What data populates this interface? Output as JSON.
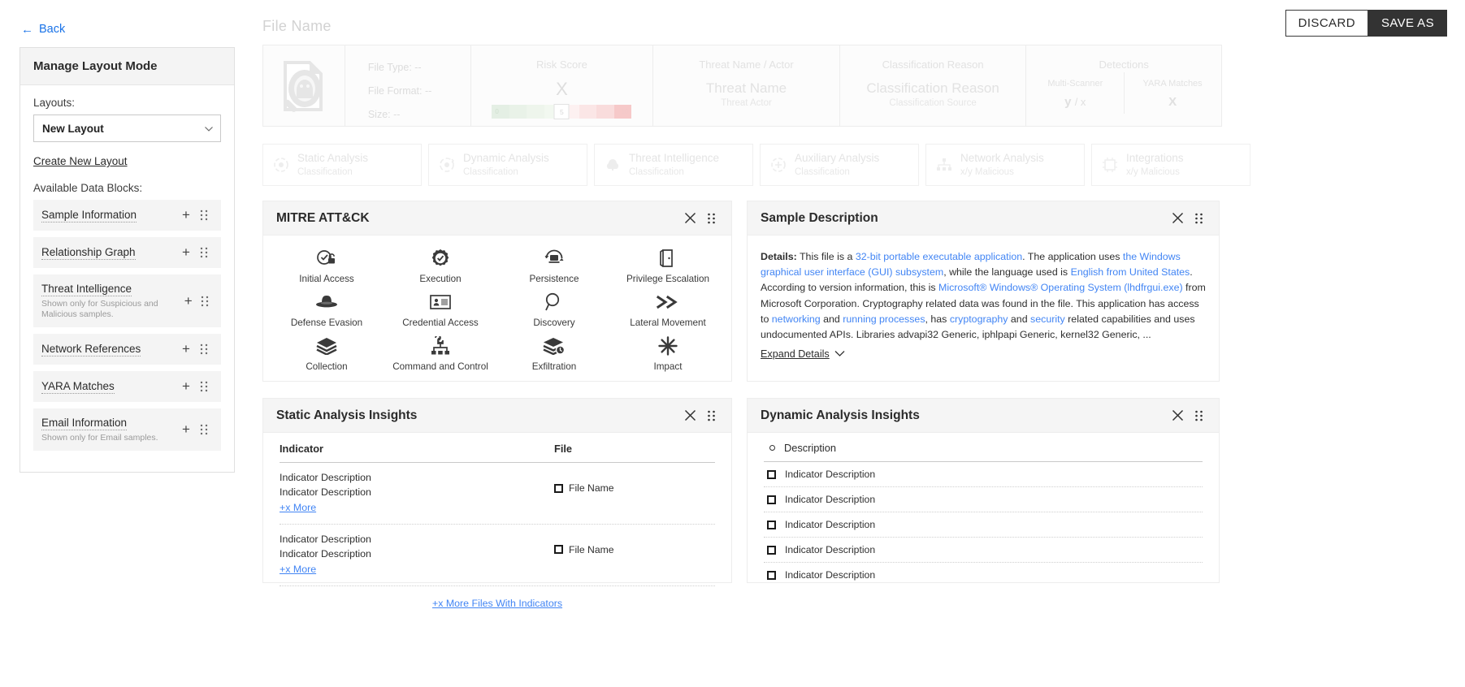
{
  "sidebar": {
    "back_label": "Back",
    "panel_title": "Manage Layout Mode",
    "layouts_label": "Layouts:",
    "selected_layout": "New Layout",
    "create_link": "Create New Layout",
    "blocks_label": "Available Data Blocks:",
    "blocks": [
      {
        "title": "Sample Information",
        "sub": ""
      },
      {
        "title": "Relationship Graph",
        "sub": ""
      },
      {
        "title": "Threat Intelligence",
        "sub": "Shown only for Suspicious and Malicious samples."
      },
      {
        "title": "Network References",
        "sub": ""
      },
      {
        "title": "YARA Matches",
        "sub": ""
      },
      {
        "title": "Email Information",
        "sub": "Shown only for Email samples."
      }
    ]
  },
  "topbar": {
    "file_name": "File  Name",
    "discard_label": "DISCARD",
    "save_as_label": "SAVE AS"
  },
  "summary": {
    "meta": {
      "file_type": "File Type:  --",
      "file_format": "File Format:  --",
      "size": "Size:  --"
    },
    "risk": {
      "header": "Risk Score",
      "value": "X",
      "min": "0",
      "mid": "5",
      "max": "10"
    },
    "threat": {
      "header": "Threat Name / Actor",
      "name": "Threat Name",
      "actor": "Threat Actor"
    },
    "classification": {
      "header": "Classification Reason",
      "name": "Classification Reason",
      "source": "Classification Source"
    },
    "detections": {
      "header": "Detections",
      "multi_scanner_label": "Multi-Scanner",
      "multi_scanner_value": "y",
      "multi_scanner_total": "/ x",
      "yara_label": "YARA Matches",
      "yara_value": "X"
    }
  },
  "tabs": [
    {
      "title": "Static Analysis",
      "sub": "Classification",
      "icon": "static-analysis-icon"
    },
    {
      "title": "Dynamic Analysis",
      "sub": "Classification",
      "icon": "dynamic-analysis-icon"
    },
    {
      "title": "Threat Intelligence",
      "sub": "Classification",
      "icon": "threat-intelligence-icon"
    },
    {
      "title": "Auxiliary Analysis",
      "sub": "Classification",
      "icon": "auxiliary-analysis-icon"
    },
    {
      "title": "Network Analysis",
      "sub": "x/y Malicious",
      "icon": "network-analysis-icon"
    },
    {
      "title": "Integrations",
      "sub": "x/y Malicious",
      "icon": "integrations-icon"
    }
  ],
  "mitre": {
    "title": "MITRE ATT&CK",
    "tactics": [
      {
        "label": "Initial Access",
        "icon": "unlock-check-icon"
      },
      {
        "label": "Execution",
        "icon": "gear-check-icon"
      },
      {
        "label": "Persistence",
        "icon": "refresh-monitor-icon"
      },
      {
        "label": "Privilege Escalation",
        "icon": "door-icon"
      },
      {
        "label": "Defense Evasion",
        "icon": "hat-icon"
      },
      {
        "label": "Credential Access",
        "icon": "id-card-icon"
      },
      {
        "label": "Discovery",
        "icon": "magnifier-icon"
      },
      {
        "label": "Lateral Movement",
        "icon": "double-chevron-icon"
      },
      {
        "label": "Collection",
        "icon": "layers-icon"
      },
      {
        "label": "Command and Control",
        "icon": "command-tree-icon"
      },
      {
        "label": "Exfiltration",
        "icon": "layers-arrow-icon"
      },
      {
        "label": "Impact",
        "icon": "burst-icon"
      }
    ]
  },
  "sample_description": {
    "title": "Sample Description",
    "details_label": "Details:",
    "expand_label": "Expand Details",
    "parts": [
      {
        "t": " This file is a ",
        "link": false
      },
      {
        "t": "32-bit portable executable application",
        "link": true
      },
      {
        "t": ". The application uses ",
        "link": false
      },
      {
        "t": "the Windows graphical user interface (GUI) subsystem",
        "link": true
      },
      {
        "t": ", while the language used is ",
        "link": false
      },
      {
        "t": "English from United States",
        "link": true
      },
      {
        "t": ". According to version information, this is ",
        "link": false
      },
      {
        "t": "Microsoft® Windows® Operating System (lhdfrgui.exe)",
        "link": true
      },
      {
        "t": " from Microsoft Corporation. Cryptography related data was found in the file. This application has access to ",
        "link": false
      },
      {
        "t": "networking",
        "link": true
      },
      {
        "t": " and ",
        "link": false
      },
      {
        "t": "running processes",
        "link": true
      },
      {
        "t": ", has ",
        "link": false
      },
      {
        "t": "cryptography",
        "link": true
      },
      {
        "t": " and ",
        "link": false
      },
      {
        "t": "security",
        "link": true
      },
      {
        "t": " related capabilities and uses undocumented APIs. Libraries advapi32 Generic, iphlpapi Generic, kernel32 Generic, ...",
        "link": false
      }
    ]
  },
  "static_insights": {
    "title": "Static Analysis Insights",
    "columns": {
      "indicator": "Indicator",
      "file": "File"
    },
    "rows": [
      {
        "lines": [
          "Indicator Description",
          "Indicator Description"
        ],
        "more": "+x More",
        "file": "File Name"
      },
      {
        "lines": [
          "Indicator Description",
          "Indicator Description"
        ],
        "more": "+x More",
        "file": "File Name"
      }
    ],
    "footer_link": "+x More Files With Indicators"
  },
  "dynamic_insights": {
    "title": "Dynamic Analysis Insights",
    "column_description": "Description",
    "rows": [
      "Indicator Description",
      "Indicator Description",
      "Indicator Description",
      "Indicator Description",
      "Indicator Description"
    ]
  }
}
